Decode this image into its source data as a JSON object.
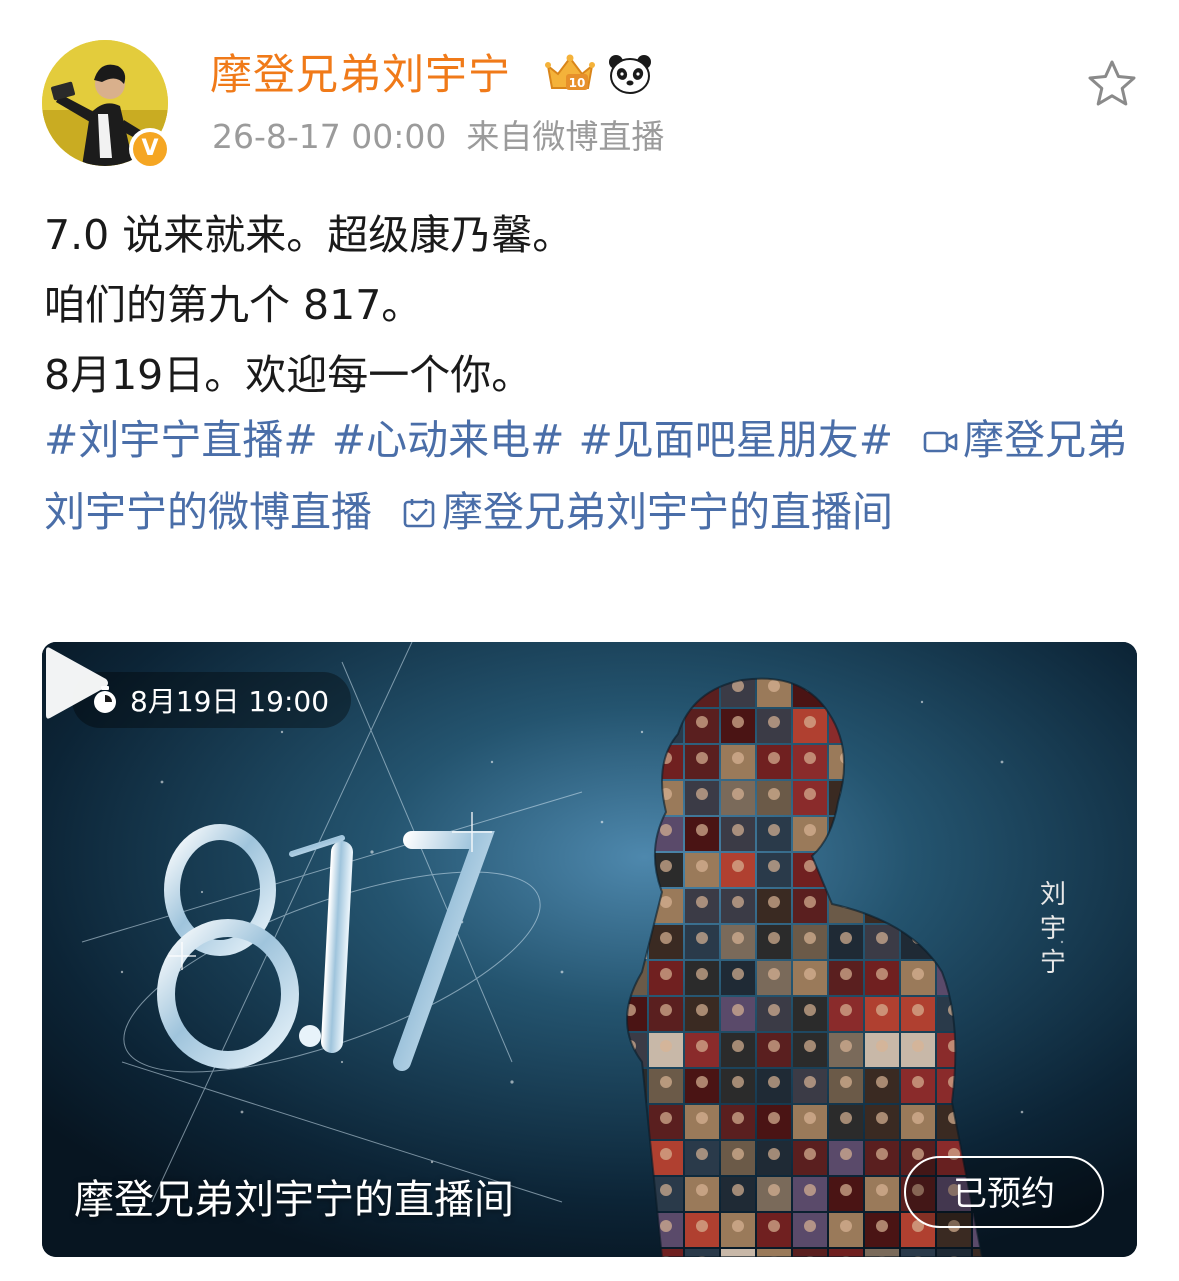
{
  "post": {
    "author": {
      "name": "摩登兄弟刘宇宁",
      "verified_badge": "V",
      "vip_level": "10"
    },
    "timestamp": "26-8-17 00:00",
    "source": "来自微博直播",
    "body_lines": [
      "7.0 说来就来。超级康乃馨。",
      "咱们的第九个 817。",
      "8月19日。欢迎每一个你。"
    ],
    "hashtags": [
      "#刘宇宁直播#",
      "#心动来电#",
      "#见面吧星朋友#"
    ],
    "links": {
      "live_stream": "摩登兄弟刘宇宁的微博直播",
      "live_room": "摩登兄弟刘宇宁的直播间"
    },
    "live_card": {
      "schedule": "8月19日 19:00",
      "poster_number": "8.17",
      "poster_name": "刘宇宁",
      "room_title": "摩登兄弟刘宇宁的直播间",
      "reserve_status": "已预约"
    },
    "colors": {
      "username": "#f07a19",
      "link": "#4a6ea8",
      "meta": "#9b9b9b",
      "verified": "#f5a623"
    },
    "icons": {
      "crown": "vip-crown-icon",
      "panda": "panda-icon",
      "star": "favorite-star-icon",
      "video": "video-camera-icon",
      "calendar": "calendar-check-icon",
      "clock": "stopwatch-icon",
      "play": "play-icon"
    }
  }
}
